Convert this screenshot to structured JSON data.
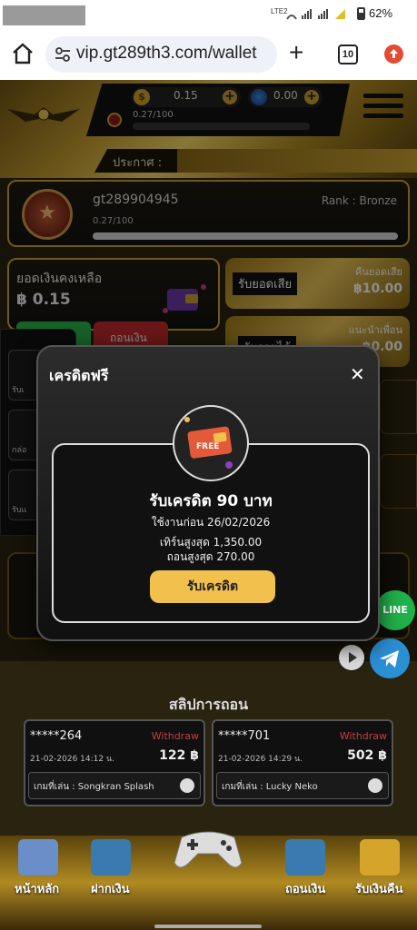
{
  "status_bar": {
    "battery": "62%",
    "network": "LTE2"
  },
  "browser": {
    "url": "vip.gt289th3.com/wallet",
    "tab_count": "10"
  },
  "header": {
    "coin_balance": "0.15",
    "gem_balance": "0.00",
    "xp": "0.27/100",
    "announce_label": "ประกาศ :"
  },
  "profile": {
    "username": "gt289904945",
    "rank": "Rank : Bronze",
    "xp": "0.27/100"
  },
  "wallet": {
    "balance_label": "ยอดเงินคงเหลือ",
    "balance_value": "฿ 0.15",
    "withdraw_label": "ถอนเงิน"
  },
  "rebate": {
    "tag": "รับยอดเสีย",
    "small_label": "คืนยอดเสีย",
    "value": "฿10.00"
  },
  "invite": {
    "tag": "รับรายได้",
    "small_label": "แนะนำเพื่อน",
    "value": "฿0.00"
  },
  "side_items": [
    "รับเ",
    "กล่อ",
    "รับแ"
  ],
  "modal": {
    "title": "เครดิตฟรี",
    "badge_text": "FREE",
    "credit_title": "รับเครดิต 90 บาท",
    "expiry": "ใช้งานก่อน 26/02/2026",
    "turnover": "เทิร์นสูงสุด 1,350.00",
    "max_withdraw": "ถอนสูงสุด 270.00",
    "claim_label": "รับเครดิต"
  },
  "line_label": "LINE",
  "slips": {
    "title": "สลิปการถอน",
    "items": [
      {
        "user": "*****264",
        "type": "Withdraw",
        "datetime": "21-02-2026 14:12 น.",
        "amount": "122 ฿",
        "game": "เกมที่เล่น : Songkran Splash"
      },
      {
        "user": "*****701",
        "type": "Withdraw",
        "datetime": "21-02-2026 14:29 น.",
        "amount": "502 ฿",
        "game": "เกมที่เล่น : Lucky Neko"
      }
    ]
  },
  "bottom_nav": {
    "home": "หน้าหลัก",
    "deposit": "ฝากเงิน",
    "withdraw": "ถอนเงิน",
    "cashback": "รับเงินคืน"
  }
}
